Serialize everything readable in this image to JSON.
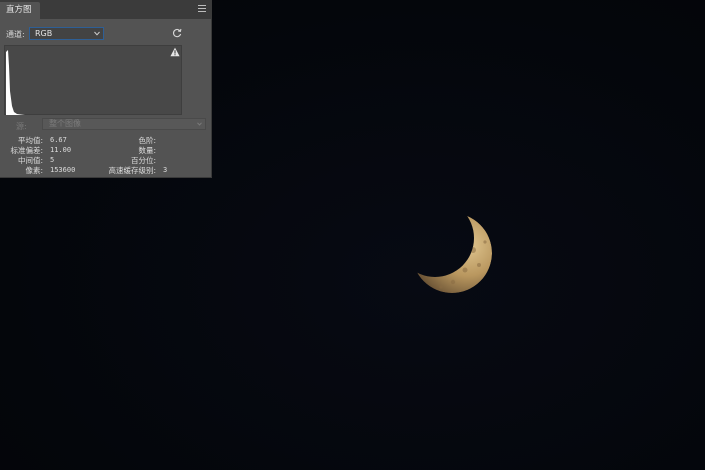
{
  "panel": {
    "tab_title": "直方图",
    "channel_label": "通道:",
    "channel_value": "RGB",
    "source_label": "源:",
    "source_value": "整个图像"
  },
  "stats": {
    "mean_label": "平均值:",
    "mean_value": "6.67",
    "stddev_label": "标准偏差:",
    "stddev_value": "11.00",
    "median_label": "中间值:",
    "median_value": "5",
    "pixels_label": "像素:",
    "pixels_value": "153600",
    "level_label": "色阶:",
    "count_label": "数量:",
    "percentile_label": "百分位:",
    "cache_label": "高速缓存级别:",
    "cache_value": "3"
  },
  "icons": {
    "menu": "menu-icon",
    "chevron": "chevron-down-icon",
    "refresh": "refresh-icon",
    "warning": "warning-icon"
  },
  "colors": {
    "panel_bg": "#535353",
    "header_bg": "#3b3b3b",
    "select_border": "#2e5f96",
    "canvas_bg": "#05070d",
    "moon": "#c9a874"
  }
}
